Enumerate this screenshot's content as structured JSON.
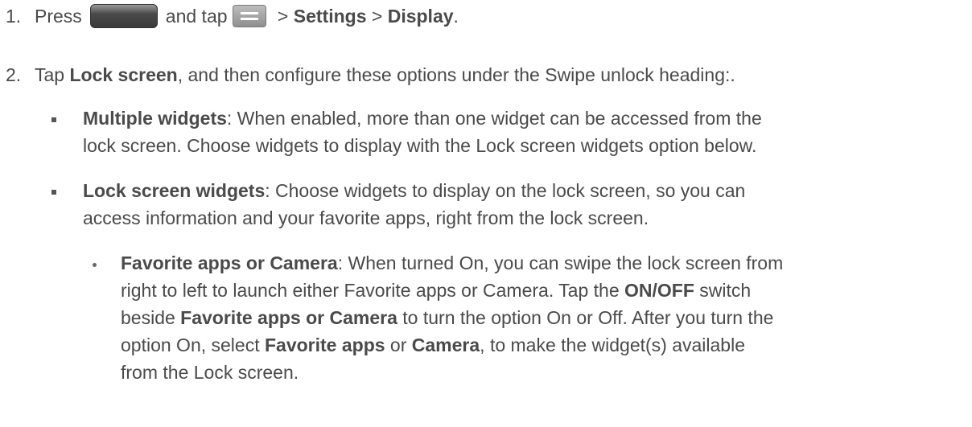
{
  "steps": [
    {
      "number": "1.",
      "parts": {
        "t1": "Press",
        "t2": "and tap",
        "t3": " > ",
        "b1": "Settings",
        "t4": " > ",
        "b2": "Display",
        "t5": "."
      }
    },
    {
      "number": "2.",
      "parts": {
        "t1": "Tap ",
        "b1": "Lock screen",
        "t2": ", and then configure these options under the Swipe unlock heading:."
      }
    }
  ],
  "options": [
    {
      "title": "Multiple widgets",
      "line1": ": When enabled, more than one widget can be accessed from the",
      "line2": "lock screen. Choose widgets to display with the Lock screen widgets option below."
    },
    {
      "title": "Lock screen widgets",
      "line1": ": Choose widgets to display on the lock screen, so you can",
      "line2": "access information and your favorite apps, right from the lock screen."
    }
  ],
  "suboption": {
    "title": "Favorite apps or Camera",
    "l1": ": When turned On, you can swipe the lock screen from",
    "l2a": "right to left to launch either Favorite apps or Camera. Tap the ",
    "l2b": "ON/OFF",
    "l2c": " switch",
    "l3a": "beside ",
    "l3b": "Favorite apps or Camera",
    "l3c": " to turn the option On or Off. After you turn the",
    "l4a": "option On, select ",
    "l4b": "Favorite apps",
    "l4c": " or ",
    "l4d": "Camera",
    "l4e": ", to make the widget(s) available",
    "l5": "from the Lock screen."
  },
  "icons": {
    "home_key": "home-key-icon",
    "menu_key": "menu-key-icon"
  }
}
